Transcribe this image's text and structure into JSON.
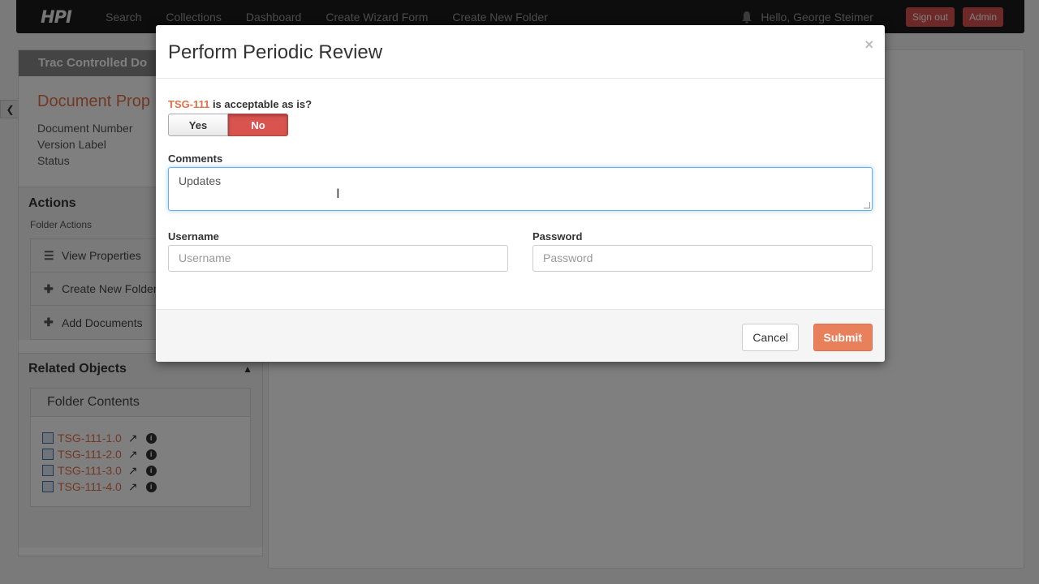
{
  "navbar": {
    "brand": "HPI",
    "items": [
      "Search",
      "Collections",
      "Dashboard",
      "Create Wizard Form",
      "Create New Folder"
    ],
    "greeting": "Hello, George Steimer",
    "signout_label": "Sign out",
    "admin_label": "Admin"
  },
  "left_panel": {
    "header": "Trac Controlled Do",
    "doc_props_title": "Document Prop",
    "props": [
      "Document Number",
      "Version Label",
      "Status"
    ],
    "actions_title": "Actions",
    "folder_actions_label": "Folder Actions",
    "actions": [
      {
        "label": "View Properties",
        "icon": "list-icon"
      },
      {
        "label": "Create New Folder",
        "icon": "plus-icon"
      },
      {
        "label": "Add Documents",
        "icon": "plus-icon"
      }
    ],
    "related_title": "Related Objects",
    "folder_contents_title": "Folder Contents",
    "folder_items": [
      "TSG-111-1.0",
      "TSG-111-2.0",
      "TSG-111-3.0",
      "TSG-111-4.0"
    ]
  },
  "modal": {
    "title": "Perform Periodic Review",
    "close_label": "×",
    "question_ref": "TSG-111",
    "question_text": "is acceptable as is?",
    "yes_label": "Yes",
    "no_label": "No",
    "selected": "No",
    "comments_label": "Comments",
    "comments_value": "Updates",
    "username_label": "Username",
    "username_placeholder": "Username",
    "password_label": "Password",
    "password_placeholder": "Password",
    "cancel_label": "Cancel",
    "submit_label": "Submit"
  },
  "colors": {
    "accent": "#e2704a",
    "no_active": "#d9534f",
    "submit": "#e8805c",
    "focus": "#66afe9"
  }
}
